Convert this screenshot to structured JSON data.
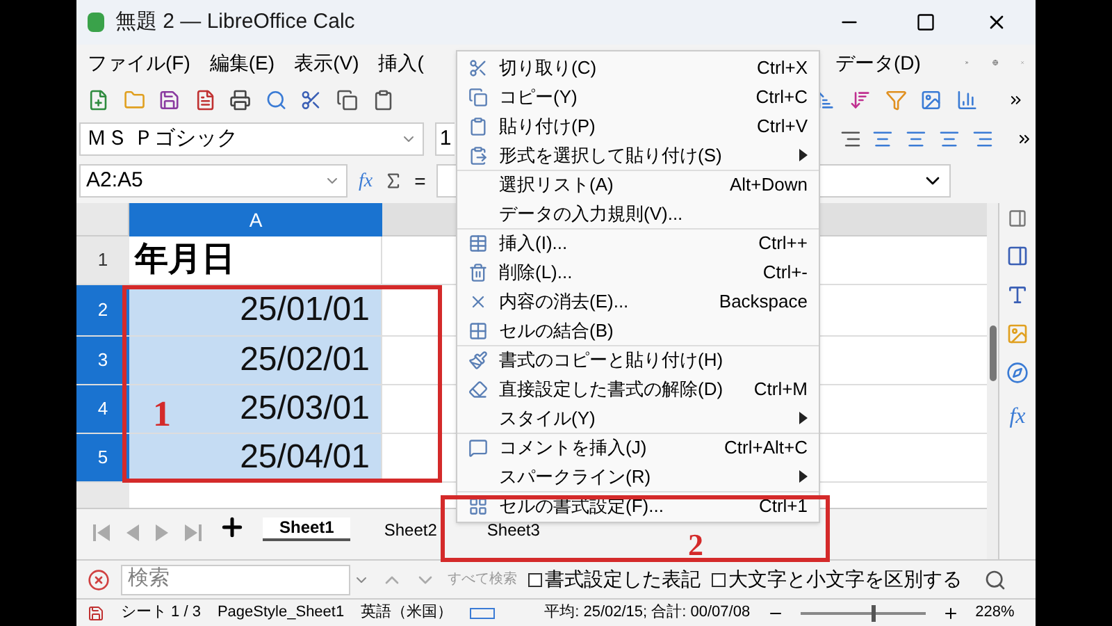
{
  "window": {
    "title": "無題 2 — LibreOffice Calc"
  },
  "menu_bar": [
    {
      "label": "ファイル(F)"
    },
    {
      "label": "編集(E)"
    },
    {
      "label": "表示(V)"
    },
    {
      "label": "挿入("
    },
    {
      "label": "データ(D)"
    }
  ],
  "font_name": {
    "value": "ＭＳ Ｐゴシック"
  },
  "font_size": {
    "value": "1"
  },
  "name_box": {
    "value": "A2:A5"
  },
  "formula_bar": {
    "function_label": "fx",
    "equals": "="
  },
  "sidebar": {
    "functions_label": "fx"
  },
  "sheet": {
    "column_header": "A",
    "rows": [
      {
        "number": "1",
        "value": "年月日",
        "selected": false
      },
      {
        "number": "2",
        "value": "25/01/01",
        "selected": true
      },
      {
        "number": "3",
        "value": "25/02/01",
        "selected": true
      },
      {
        "number": "4",
        "value": "25/03/01",
        "selected": true
      },
      {
        "number": "5",
        "value": "25/04/01",
        "selected": true
      }
    ]
  },
  "annotations": [
    {
      "label": "1"
    },
    {
      "label": "2"
    }
  ],
  "context_menu": {
    "items": [
      {
        "label": "切り取り(C)",
        "shortcut": "Ctrl+X",
        "submenu": false,
        "separator_before": false
      },
      {
        "label": "コピー(Y)",
        "shortcut": "Ctrl+C",
        "submenu": false,
        "separator_before": false
      },
      {
        "label": "貼り付け(P)",
        "shortcut": "Ctrl+V",
        "submenu": false,
        "separator_before": false
      },
      {
        "label": "形式を選択して貼り付け(S)",
        "submenu": true,
        "separator_before": false
      },
      {
        "label": "選択リスト(A)",
        "shortcut": "Alt+Down",
        "submenu": false,
        "separator_before": true
      },
      {
        "label": "データの入力規則(V)...",
        "submenu": false,
        "separator_before": false
      },
      {
        "label": "挿入(I)...",
        "shortcut": "Ctrl++",
        "submenu": false,
        "separator_before": true
      },
      {
        "label": "削除(L)...",
        "shortcut": "Ctrl+-",
        "submenu": false,
        "separator_before": false
      },
      {
        "label": "内容の消去(E)...",
        "shortcut": "Backspace",
        "submenu": false,
        "separator_before": false
      },
      {
        "label": "セルの結合(B)",
        "submenu": false,
        "separator_before": false
      },
      {
        "label": "書式のコピーと貼り付け(H)",
        "submenu": false,
        "separator_before": true
      },
      {
        "label": "直接設定した書式の解除(D)",
        "shortcut": "Ctrl+M",
        "submenu": false,
        "separator_before": false
      },
      {
        "label": "スタイル(Y)",
        "submenu": true,
        "separator_before": false
      },
      {
        "label": "コメントを挿入(J)",
        "shortcut": "Ctrl+Alt+C",
        "submenu": false,
        "separator_before": true
      },
      {
        "label": "スパークライン(R)",
        "submenu": true,
        "separator_before": false
      },
      {
        "label": "セルの書式設定(F)...",
        "shortcut": "Ctrl+1",
        "submenu": false,
        "separator_before": true
      }
    ]
  },
  "sheet_tabs": [
    {
      "label": "Sheet1",
      "selected": true
    },
    {
      "label": "Sheet2",
      "selected": false
    },
    {
      "label": "Sheet3",
      "selected": false
    }
  ],
  "find_bar": {
    "placeholder": "検索",
    "find_all": "すべて検索",
    "options": [
      {
        "label": "書式設定した表記",
        "checked": false
      },
      {
        "label": "大文字と小文字を区別する",
        "checked": false
      }
    ]
  },
  "status_bar": {
    "sheet": "シート 1 / 3",
    "page_style": "PageStyle_Sheet1",
    "language": "英語（米国）",
    "summary": "平均: 25/02/15; 合計: 00/07/08",
    "zoom": {
      "level": 0.6
    },
    "zoom_percent": "228%"
  }
}
